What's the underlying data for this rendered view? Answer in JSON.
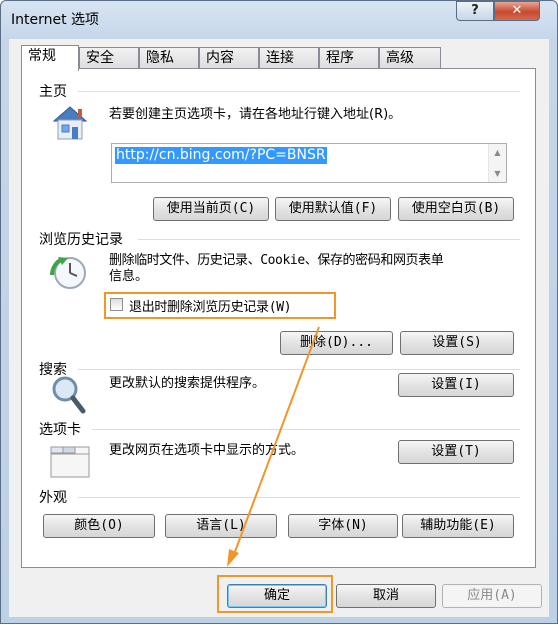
{
  "window": {
    "title": "Internet 选项",
    "help_label": "?",
    "close_label": "✕"
  },
  "tabs": [
    {
      "label": "常规",
      "active": true
    },
    {
      "label": "安全"
    },
    {
      "label": "隐私"
    },
    {
      "label": "内容"
    },
    {
      "label": "连接"
    },
    {
      "label": "程序"
    },
    {
      "label": "高级"
    }
  ],
  "homepage": {
    "section_label": "主页",
    "description": "若要创建主页选项卡，请在各地址行键入地址(R)。",
    "url": "http://cn.bing.com/?PC=BNSR",
    "icon": "house-icon",
    "buttons": {
      "use_current": "使用当前页(C)",
      "use_default": "使用默认值(F)",
      "use_blank": "使用空白页(B)"
    }
  },
  "history": {
    "section_label": "浏览历史记录",
    "description_line1": "删除临时文件、历史记录、Cookie、保存的密码和网页表单",
    "description_line2": "信息。",
    "checkbox_label": "退出时删除浏览历史记录(W)",
    "checkbox_checked": false,
    "icon": "history-clock-icon",
    "buttons": {
      "delete": "删除(D)...",
      "settings": "设置(S)"
    }
  },
  "search": {
    "section_label": "搜索",
    "description": "更改默认的搜索提供程序。",
    "icon": "magnifier-icon",
    "buttons": {
      "settings": "设置(I)"
    }
  },
  "tabs_section": {
    "section_label": "选项卡",
    "description": "更改网页在选项卡中显示的方式。",
    "icon": "tabbed-window-icon",
    "buttons": {
      "settings": "设置(T)"
    }
  },
  "appearance": {
    "section_label": "外观",
    "buttons": {
      "colors": "颜色(O)",
      "languages": "语言(L)",
      "fonts": "字体(N)",
      "accessibility": "辅助功能(E)"
    }
  },
  "footer": {
    "ok": "确定",
    "cancel": "取消",
    "apply": "应用(A)"
  },
  "colors": {
    "highlight": "#f0962a",
    "selection": "#3399ff",
    "close_button": "#c74a30"
  }
}
